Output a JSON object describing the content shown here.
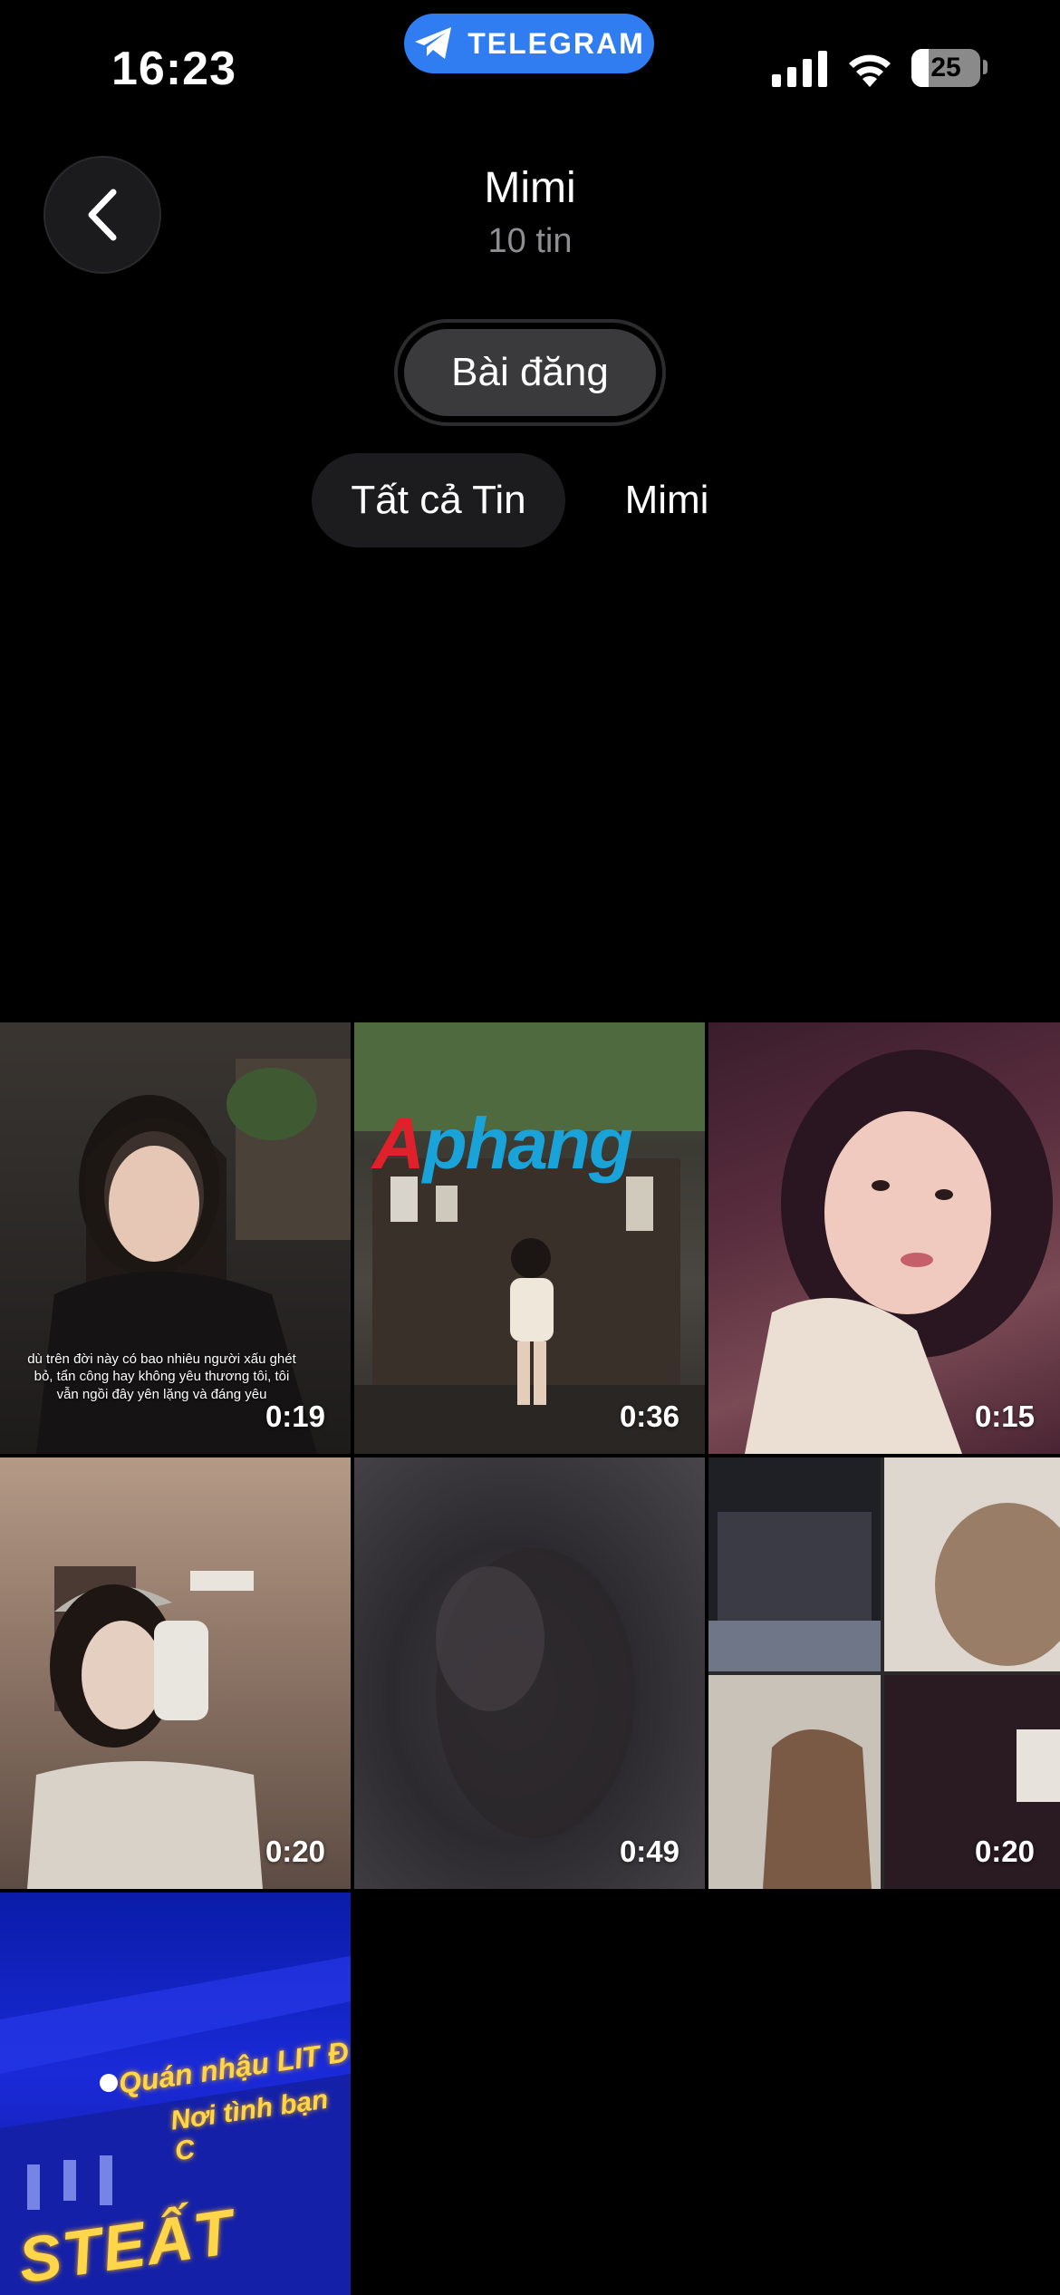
{
  "status_bar": {
    "time": "16:23",
    "app_pill": "TELEGRAM",
    "battery": "25",
    "battery_fraction": 0.25
  },
  "header": {
    "title": "Mimi",
    "subtitle": "10 tin"
  },
  "section_pill": "Bài đăng",
  "filter_tabs": [
    {
      "label": "Tất cả Tin",
      "active": true
    },
    {
      "label": "Mimi",
      "active": false
    }
  ],
  "media": [
    {
      "duration": "0:19",
      "caption": "dù trên đời này có bao nhiêu người xấu ghét bỏ, tẩn công hay không yêu thương tôi, tôi vẫn ngồi đây yên lặng và đáng yêu"
    },
    {
      "duration": "0:36",
      "watermark": "Aphang"
    },
    {
      "duration": "0:15"
    },
    {
      "duration": "0:20"
    },
    {
      "duration": "0:49"
    },
    {
      "duration": "0:20"
    },
    {
      "sign_line_1": "Quán nhậu LIT Đ",
      "sign_line_2": "Nơi tình bạn C",
      "sign_line_3": "STEẤT"
    }
  ],
  "colors": {
    "background": "#000000",
    "telegram_blue": "#2f7df1",
    "subtitle_gray": "#8e8e93"
  }
}
